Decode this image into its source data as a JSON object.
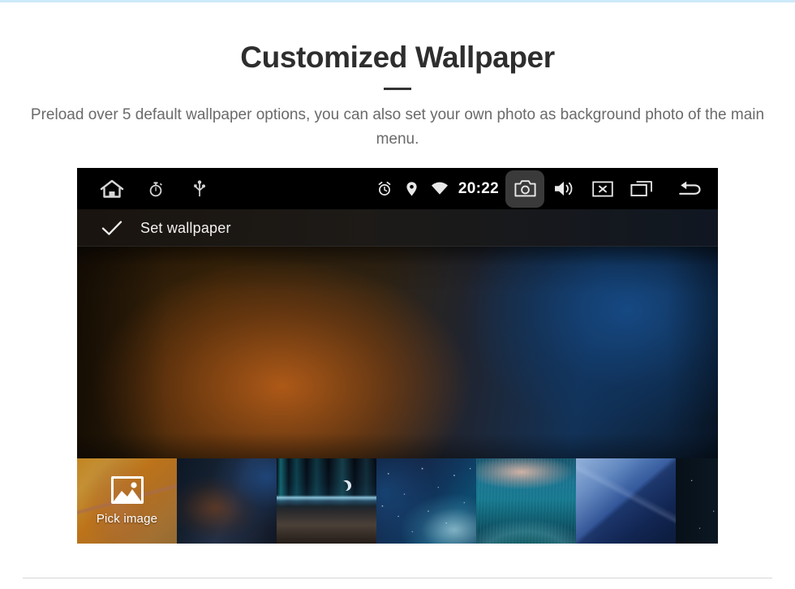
{
  "hero": {
    "title": "Customized Wallpaper",
    "subtitle": "Preload over 5 default wallpaper options, you can also set your own photo as background photo of the main menu."
  },
  "device": {
    "status_bar": {
      "left_icons": [
        {
          "name": "home-icon",
          "label": "Home"
        },
        {
          "name": "stopwatch-icon",
          "label": "Stopwatch"
        },
        {
          "name": "usb-icon",
          "label": "USB"
        }
      ],
      "right_icons": [
        {
          "name": "alarm-icon",
          "label": "Alarm"
        },
        {
          "name": "location-pin-icon",
          "label": "Location"
        },
        {
          "name": "wifi-icon",
          "label": "Wi-Fi"
        }
      ],
      "clock": "20:22",
      "nav_buttons": [
        {
          "name": "camera-button",
          "label": "Screenshot",
          "highlighted": true
        },
        {
          "name": "volume-button",
          "label": "Volume"
        },
        {
          "name": "close-button",
          "label": "Close"
        },
        {
          "name": "recent-apps-button",
          "label": "Recent apps"
        },
        {
          "name": "back-button",
          "label": "Back"
        }
      ]
    },
    "action_bar": {
      "confirm_label": "Set wallpaper"
    },
    "thumbnails": [
      {
        "name": "pick-image",
        "label": "Pick image",
        "has_label": true
      },
      {
        "name": "wallpaper-blue-bokeh",
        "label": "",
        "has_label": false
      },
      {
        "name": "wallpaper-aurora-earth",
        "label": "",
        "has_label": false
      },
      {
        "name": "wallpaper-starry-nebula",
        "label": "",
        "has_label": false
      },
      {
        "name": "wallpaper-teal-wave",
        "label": "",
        "has_label": false
      },
      {
        "name": "wallpaper-blue-facets",
        "label": "",
        "has_label": false
      },
      {
        "name": "wallpaper-eclipse",
        "label": "",
        "has_label": false
      }
    ]
  },
  "colors": {
    "top_rule": "#cdeafa",
    "title": "#2e2e2e",
    "subtitle": "#6a6a6a",
    "divider": "#333333",
    "device_bg": "#000000",
    "bottom_rule": "#d6d6d6"
  }
}
